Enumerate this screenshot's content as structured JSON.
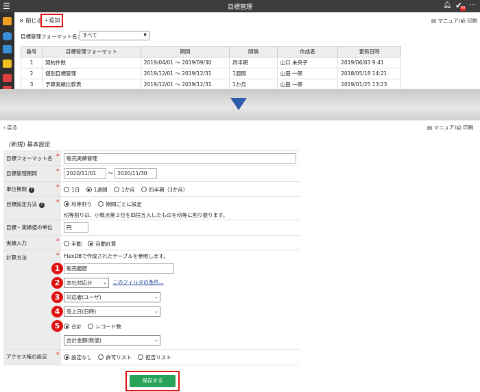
{
  "app": {
    "title": "目標管理",
    "notification_badge": "99",
    "menu_icon": "hamburger-icon",
    "bell_icon": "bell-icon",
    "check_icon": "check-icon",
    "more_icon": "more-icon"
  },
  "sidenav": {
    "items": [
      {
        "icon": "home-icon",
        "color": "#f0a020"
      },
      {
        "icon": "database-icon",
        "color": "#3a8fd8"
      },
      {
        "icon": "chat-icon",
        "color": "#3a8fd8"
      },
      {
        "icon": "briefcase-icon",
        "color": "#f0c020"
      },
      {
        "icon": "mail-icon",
        "color": "#e04040"
      },
      {
        "icon": "gear-icon",
        "color": "#e04040"
      }
    ]
  },
  "toolbar": {
    "close_label": "閉じる",
    "add_label": "＋追加",
    "manual_label": "マニュアル",
    "print_label": "印刷"
  },
  "filter": {
    "label": "目標管理フォーマット名：",
    "value": "すべて"
  },
  "table": {
    "headers": [
      "番号",
      "目標管理フォーマット",
      "期間",
      "間隔",
      "作成者",
      "更新日時"
    ],
    "rows": [
      [
        "1",
        "契約件数",
        "2019/04/01 ～ 2019/09/30",
        "四半期",
        "山口 未央子",
        "2019/06/03 9:41"
      ],
      [
        "2",
        "個別目標管理",
        "2019/12/01 ～ 2019/12/31",
        "1週間",
        "山田 一郎",
        "2018/05/18 14:21"
      ],
      [
        "3",
        "予算実績比較表",
        "2019/12/01 ～ 2019/12/31",
        "1か月",
        "山田 一郎",
        "2019/01/25 13:23"
      ]
    ]
  },
  "form": {
    "back_label": "戻る",
    "manual_label": "マニュアル",
    "print_label": "印刷",
    "section_title": "(新規) 基本設定",
    "format_name": {
      "label": "目標フォーマット名",
      "value": "販売実績管理"
    },
    "period": {
      "label": "目標管理期間",
      "from": "2020/11/01",
      "sep": "～",
      "to": "2020/11/30"
    },
    "unit_period": {
      "label": "単位期間",
      "options": [
        "1日",
        "1週間",
        "1か月",
        "四半期（3か月）"
      ],
      "selected": 1
    },
    "method": {
      "label": "目標設定方法",
      "options": [
        "均等割り",
        "期間ごとに設定"
      ],
      "selected": 0,
      "note": "均等割りは、小数点第３位を四捨五入したものを均等に割り振ります。"
    },
    "unit": {
      "label": "目標・実績値の単位",
      "value": "円"
    },
    "actual_input": {
      "label": "実績入力",
      "options": [
        "手動",
        "自動計算"
      ],
      "selected": 1
    },
    "calc": {
      "label": "計算方法",
      "intro": "FlexDBで作成されたテーブルを参照します。",
      "numbers": [
        "1",
        "2",
        "3",
        "4",
        "5"
      ],
      "table_value": "販売履歴",
      "filter_value": "本社対応分",
      "filter_link": "このフィルタの条件...",
      "person_value": "対応者(ユーザ)",
      "date_value": "売上日(日時)",
      "agg_options": [
        "合計",
        "レコード数"
      ],
      "agg_selected": 0,
      "field_value": "合計金額(数値)"
    },
    "access": {
      "label": "アクセス権の設定",
      "options": [
        "設定なし",
        "許可リスト",
        "拒否リスト"
      ],
      "selected": 0
    },
    "save_label": "保存する"
  }
}
